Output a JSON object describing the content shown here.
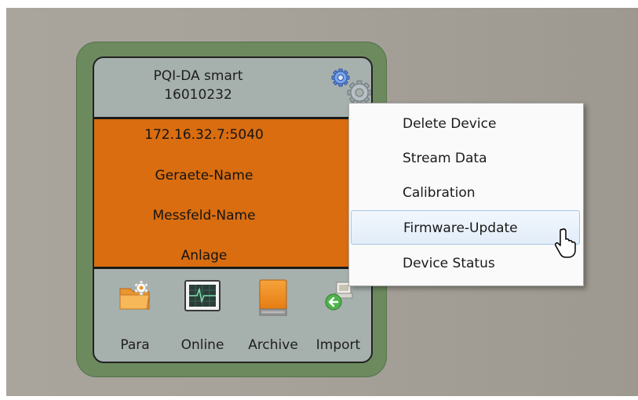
{
  "device": {
    "name": "PQI-DA smart",
    "serial": "16010232",
    "address": "172.16.32.7:5040",
    "device_name": "Geraete-Name",
    "field_name": "Messfeld-Name",
    "plant": "Anlage"
  },
  "tools": [
    {
      "label": "Para",
      "icon": "folder-gear-icon"
    },
    {
      "label": "Online",
      "icon": "monitor-waveform-icon"
    },
    {
      "label": "Archive",
      "icon": "archive-drive-icon"
    },
    {
      "label": "Import",
      "icon": "import-arrow-icon"
    }
  ],
  "context_menu": {
    "items": [
      "Delete Device",
      "Stream Data",
      "Calibration",
      "Firmware-Update",
      "Device Status"
    ],
    "highlighted": "Firmware-Update"
  },
  "colors": {
    "card_border": "#6d8a5f",
    "card_body": "#a6b0ad",
    "info_panel": "#d96d10",
    "menu_hover": "#e2edf9"
  }
}
